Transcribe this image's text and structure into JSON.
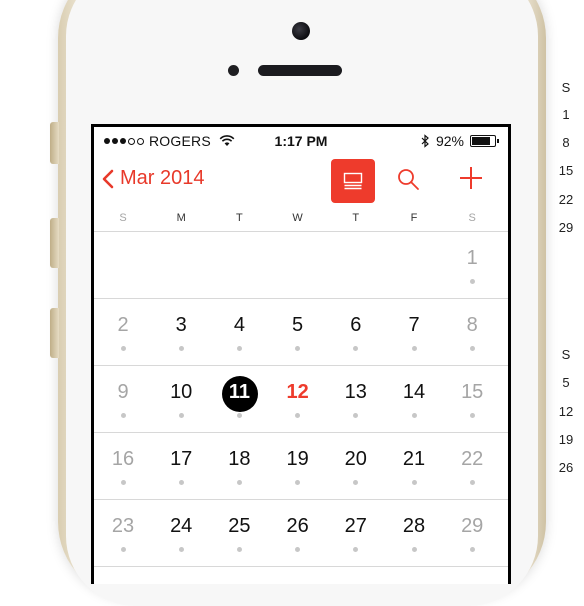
{
  "status_bar": {
    "carrier": "ROGERS",
    "time": "1:17 PM",
    "battery": "92%",
    "battery_level": 0.92
  },
  "nav": {
    "back_label": "Mar 2014",
    "list_icon": "list-view-icon",
    "search_icon": "search-icon",
    "add_icon": "plus-icon"
  },
  "weekday_headers": [
    "S",
    "M",
    "T",
    "W",
    "T",
    "F",
    "S"
  ],
  "weeks": [
    [
      "",
      "",
      "",
      "",
      "",
      "",
      "1"
    ],
    [
      "2",
      "3",
      "4",
      "5",
      "6",
      "7",
      "8"
    ],
    [
      "9",
      "10",
      "11",
      "12",
      "13",
      "14",
      "15"
    ],
    [
      "16",
      "17",
      "18",
      "19",
      "20",
      "21",
      "22"
    ],
    [
      "23",
      "24",
      "25",
      "26",
      "27",
      "28",
      "29"
    ]
  ],
  "selected_day": "11",
  "today": "12",
  "background_calendar": {
    "upper": [
      "S",
      "1",
      "8",
      "15",
      "22",
      "29"
    ],
    "lower": [
      "S",
      "5",
      "12",
      "19",
      "26"
    ]
  },
  "colors": {
    "accent": "#ee3b2c",
    "selected": "#000000"
  }
}
